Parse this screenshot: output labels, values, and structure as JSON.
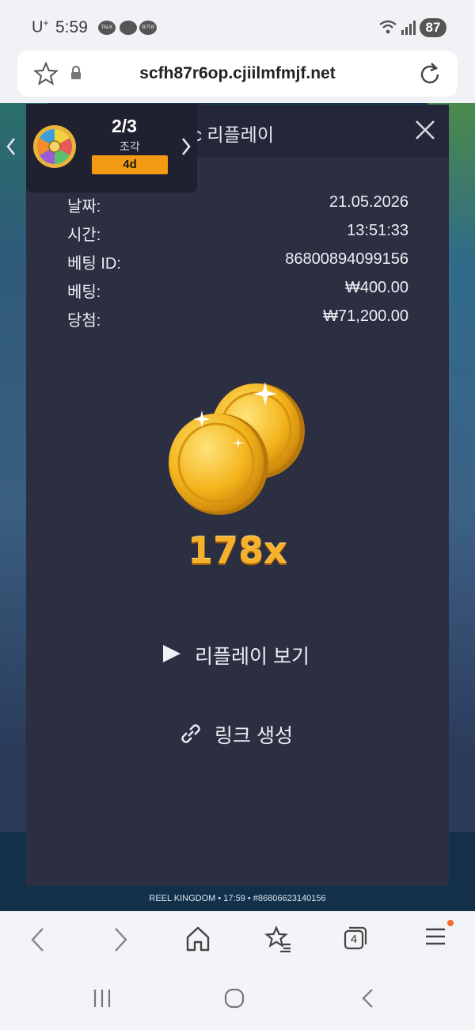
{
  "status_bar": {
    "carrier": "U",
    "carrier_sup": "+",
    "time": "5:59",
    "notifications": [
      "TALK",
      "",
      "요기요"
    ],
    "battery": "87"
  },
  "browser": {
    "url": "scfh87r6op.cjiilmfmjf.net",
    "tabs_count": "4"
  },
  "fragment": {
    "count": "2/3",
    "label": "조각",
    "badge": "4d"
  },
  "modal": {
    "title": "matic 리플레이",
    "rows": [
      {
        "label": "날짜:",
        "value": "21.05.2026"
      },
      {
        "label": "시간:",
        "value": "13:51:33"
      },
      {
        "label": "베팅 ID:",
        "value": "86800894099156"
      },
      {
        "label": "베팅:",
        "value": "₩400.00"
      },
      {
        "label": "당첨:",
        "value": "₩71,200.00"
      }
    ],
    "multiplier": "178x",
    "replay_label": "리플레이 보기",
    "link_label": "링크 생성"
  },
  "game_footer": {
    "text": "REEL KINGDOM • 17:59 • #86806623140156"
  },
  "colors": {
    "accent": "#f39a12",
    "modal_bg": "#2c2f41",
    "coin": "#f5b12a"
  }
}
